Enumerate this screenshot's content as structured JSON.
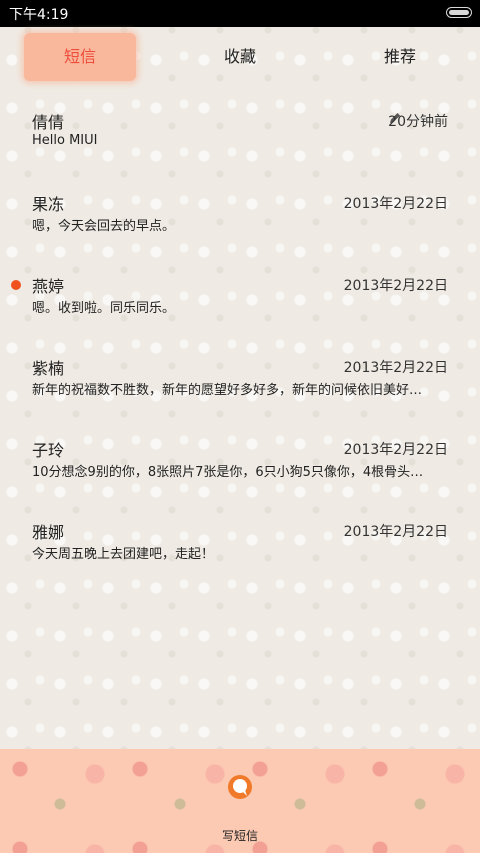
{
  "status_bar": {
    "time": "下午4:19"
  },
  "tabs": [
    {
      "label": "短信",
      "active": true
    },
    {
      "label": "收藏",
      "active": false
    },
    {
      "label": "推荐",
      "active": false
    }
  ],
  "threads": [
    {
      "name": "倩倩",
      "time": "20分钟前",
      "message": "Hello MIUI",
      "draft": true,
      "unread": false
    },
    {
      "name": "果冻",
      "time": "2013年2月22日",
      "message": "嗯，今天会回去的早点。",
      "draft": false,
      "unread": false
    },
    {
      "name": "燕婷",
      "time": "2013年2月22日",
      "message": "嗯。收到啦。同乐同乐。",
      "draft": false,
      "unread": true
    },
    {
      "name": "紫楠",
      "time": "2013年2月22日",
      "message": "新年的祝福数不胜数，新年的愿望好多好多，新年的问候依旧美好…",
      "draft": false,
      "unread": false
    },
    {
      "name": "子玲",
      "time": "2013年2月22日",
      "message": "10分想念9别的你，8张照片7张是你，6只小狗5只像你，4根骨头…",
      "draft": false,
      "unread": false
    },
    {
      "name": "雅娜",
      "time": "2013年2月22日",
      "message": "今天周五晚上去团建吧，走起！",
      "draft": false,
      "unread": false
    }
  ],
  "bottom_bar": {
    "compose_label": "写短信",
    "compose_icon": "compose-message-icon"
  },
  "colors": {
    "accent": "#ef4d3c",
    "active_tab_bg": "#f9b79c",
    "unread_dot": "#f0521f",
    "bottom_bar_bg": "#fcc9b3"
  }
}
